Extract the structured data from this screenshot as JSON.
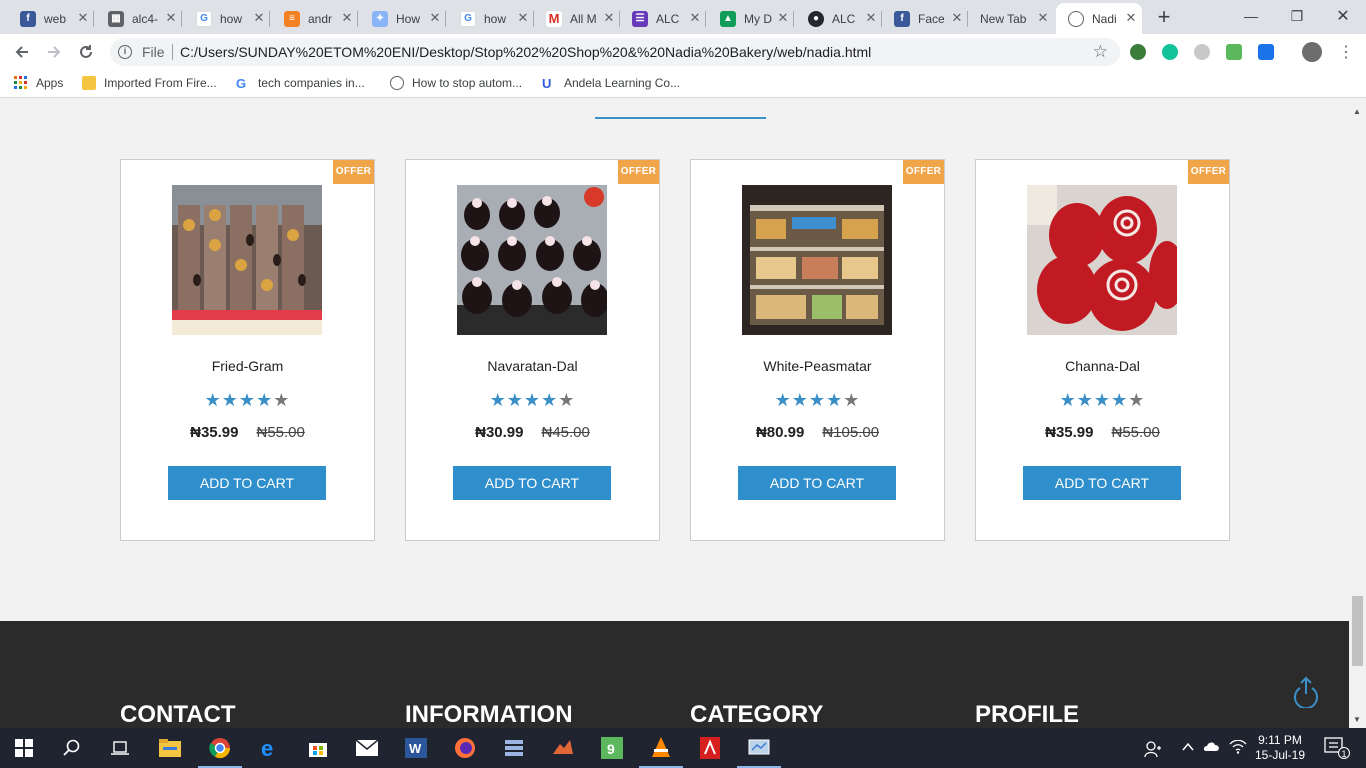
{
  "browser": {
    "tabs": [
      {
        "title": "web",
        "icon": "facebook-icon",
        "color": "#3b5998"
      },
      {
        "title": "alc4-",
        "icon": "grid-icon",
        "color": "#5f6368"
      },
      {
        "title": "how",
        "icon": "google-icon",
        "color": "#4285f4"
      },
      {
        "title": "andr",
        "icon": "stackoverflow-icon",
        "color": "#f48024"
      },
      {
        "title": "How",
        "icon": "page-icon",
        "color": "#8ab4f8"
      },
      {
        "title": "how",
        "icon": "google-icon",
        "color": "#4285f4"
      },
      {
        "title": "All M",
        "icon": "gmail-icon",
        "color": "#d93025"
      },
      {
        "title": "ALC",
        "icon": "forms-icon",
        "color": "#673ab7"
      },
      {
        "title": "My D",
        "icon": "drive-icon",
        "color": "#0f9d58"
      },
      {
        "title": "ALC",
        "icon": "github-icon",
        "color": "#24292e"
      },
      {
        "title": "Face",
        "icon": "facebook-icon",
        "color": "#3b5998"
      },
      {
        "title": "New Tab",
        "icon": "",
        "color": ""
      },
      {
        "title": "Nadi",
        "icon": "globe-icon",
        "color": "#5f6368"
      }
    ],
    "address": {
      "scheme": "File",
      "url": "C:/Users/SUNDAY%20ETOM%20ENI/Desktop/Stop%202%20Shop%20&%20Nadia%20Bakery/web/nadia.html"
    },
    "bookmarks": [
      {
        "label": "Apps",
        "icon": "apps-icon"
      },
      {
        "label": "Imported From Fire...",
        "icon": "folder-icon"
      },
      {
        "label": "tech companies in...",
        "icon": "google-icon"
      },
      {
        "label": "How to stop autom...",
        "icon": "globe-icon"
      },
      {
        "label": "Andela Learning Co...",
        "icon": "andela-icon"
      }
    ]
  },
  "products": [
    {
      "name": "Fried-Gram",
      "badge": "OFFER",
      "rating": 4,
      "max_rating": 5,
      "price": "₦35.99",
      "old_price": "₦55.00",
      "cta": "ADD TO CART"
    },
    {
      "name": "Navaratan-Dal",
      "badge": "OFFER",
      "rating": 4,
      "max_rating": 5,
      "price": "₦30.99",
      "old_price": "₦45.00",
      "cta": "ADD TO CART"
    },
    {
      "name": "White-Peasmatar",
      "badge": "OFFER",
      "rating": 4,
      "max_rating": 5,
      "price": "₦80.99",
      "old_price": "₦105.00",
      "cta": "ADD TO CART"
    },
    {
      "name": "Channa-Dal",
      "badge": "OFFER",
      "rating": 4,
      "max_rating": 5,
      "price": "₦35.99",
      "old_price": "₦55.00",
      "cta": "ADD TO CART"
    }
  ],
  "footer": {
    "headings": [
      "CONTACT",
      "INFORMATION",
      "CATEGORY",
      "PROFILE"
    ]
  },
  "colors": {
    "accent": "#2f8fcc",
    "offer": "#f0a548",
    "footer_bg": "#2b2b2b"
  },
  "taskbar": {
    "time": "9:11 PM",
    "date": "15-Jul-19",
    "notifications": "1"
  }
}
